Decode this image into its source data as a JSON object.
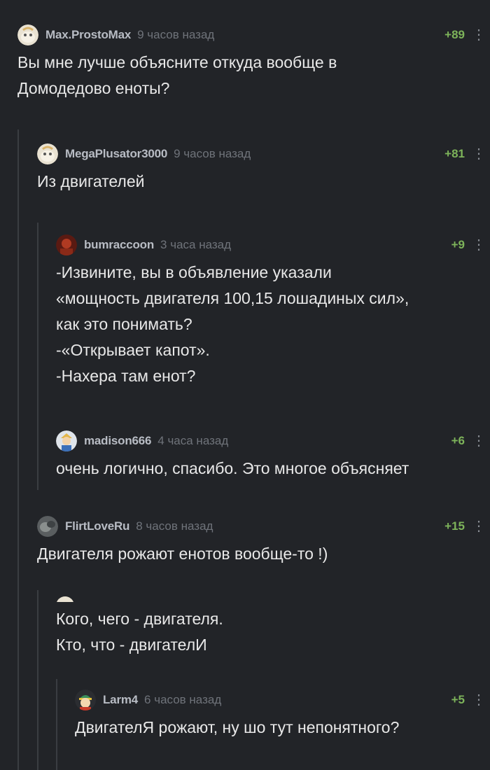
{
  "comments": [
    {
      "author": "Max.ProstoMax",
      "time": "9 часов назад",
      "rating": "+89",
      "lines": [
        "Вы мне лучше объясните откуда вообще в",
        "Домодедово еноты?"
      ],
      "avatar_icon": "mascot-avatar"
    },
    {
      "author": "MegaPlusator3000",
      "time": "9 часов назад",
      "rating": "+81",
      "lines": [
        "Из двигателей"
      ],
      "avatar_icon": "mascot-avatar"
    },
    {
      "author": "bumraccoon",
      "time": "3 часа назад",
      "rating": "+9",
      "lines": [
        "-Извините, вы в объявление указали",
        "«мощность двигателя 100,15 лошадиных сил»,",
        "как это понимать?",
        "-«Открывает капот».",
        "-Нахера там енот?"
      ],
      "avatar_icon": "red-avatar"
    },
    {
      "author": "madison666",
      "time": "4 часа назад",
      "rating": "+6",
      "lines": [
        "очень логично, спасибо. Это многое объясняет"
      ],
      "avatar_icon": "character-avatar"
    },
    {
      "author": "FlirtLoveRu",
      "time": "8 часов назад",
      "rating": "+15",
      "lines": [
        "Двигателя рожают енотов вообще-то !)"
      ],
      "avatar_icon": "photo-avatar"
    },
    {
      "lines": [
        "Кого, чего - двигателя.",
        "Кто, что  - двигателИ"
      ]
    },
    {
      "author": "Larm4",
      "time": "6 часов назад",
      "rating": "+5",
      "lines": [
        "ДвигателЯ рожают, ну шо тут непонятного?"
      ],
      "avatar_icon": "cartoon-avatar"
    }
  ],
  "colors": {
    "background": "#222428",
    "rating_green": "#7db35a",
    "thread_line": "#3a3d42"
  }
}
